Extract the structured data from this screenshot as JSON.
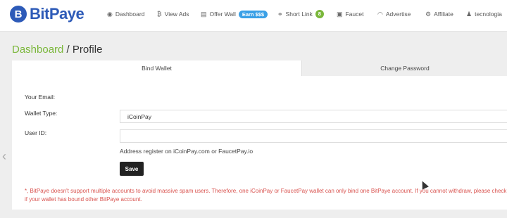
{
  "brand": {
    "name": "BitPaye",
    "mark": "B",
    "color": "#2e5bb8"
  },
  "nav": [
    {
      "label": "Dashboard",
      "icon": "dashboard-icon",
      "glyph": "◉"
    },
    {
      "label": "View Ads",
      "icon": "bitcoin-icon",
      "glyph": "₿"
    },
    {
      "label": "Offer Wall",
      "icon": "document-icon",
      "glyph": "▤",
      "badge": "Earn $$$"
    },
    {
      "label": "Short Link",
      "icon": "link-icon",
      "glyph": "⚭",
      "badge": "8"
    },
    {
      "label": "Faucet",
      "icon": "money-icon",
      "glyph": "▣"
    },
    {
      "label": "Advertise",
      "icon": "wifi-icon",
      "glyph": "◠"
    },
    {
      "label": "Affiliate",
      "icon": "gears-icon",
      "glyph": "⚙"
    },
    {
      "label": "tecnologia",
      "icon": "user-icon",
      "glyph": "♟"
    }
  ],
  "breadcrumb": {
    "home": "Dashboard",
    "separator": " / ",
    "current": "Profile"
  },
  "tabs": {
    "bind": "Bind Wallet",
    "password": "Change Password"
  },
  "form": {
    "email_label": "Your Email:",
    "wallet_type_label": "Wallet Type:",
    "wallet_type_value": "iCoinPay",
    "user_id_label": "User ID:",
    "user_id_value": "",
    "hint": "Address register on iCoinPay.com or FaucetPay.io",
    "save": "Save"
  },
  "warning": "*, BitPaye doesn't support multiple accounts to avoid massive spam users. Therefore, one iCoinPay or FaucetPay wallet can only bind one BitPaye account. If you cannot withdraw, please check if your wallet has bound other BitPaye account.",
  "colors": {
    "accent_green": "#7ab73a",
    "warning_red": "#d9534f",
    "badge_blue": "#3aa0e6"
  }
}
